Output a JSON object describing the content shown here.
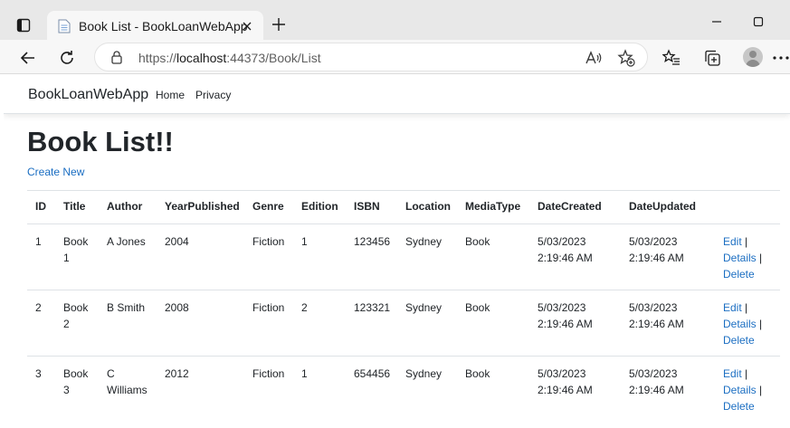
{
  "browser": {
    "tab_title": "Book List - BookLoanWebApp",
    "url_prefix": "https://",
    "url_host": "localhost",
    "url_rest": ":44373/Book/List"
  },
  "site": {
    "brand": "BookLoanWebApp",
    "nav": [
      "Home",
      "Privacy"
    ],
    "heading": "Book List!!",
    "create_new": "Create New"
  },
  "table": {
    "columns": [
      "ID",
      "Title",
      "Author",
      "YearPublished",
      "Genre",
      "Edition",
      "ISBN",
      "Location",
      "MediaType",
      "DateCreated",
      "DateUpdated"
    ],
    "rows": [
      {
        "id": "1",
        "title": [
          "Book",
          "1"
        ],
        "author": [
          "A Jones"
        ],
        "year": "2004",
        "genre": "Fiction",
        "edition": "1",
        "isbn": "123456",
        "location": "Sydney",
        "media": "Book",
        "created": [
          "5/03/2023",
          "2:19:46 AM"
        ],
        "updated": [
          "5/03/2023",
          "2:19:46 AM"
        ]
      },
      {
        "id": "2",
        "title": [
          "Book",
          "2"
        ],
        "author": [
          "B Smith"
        ],
        "year": "2008",
        "genre": "Fiction",
        "edition": "2",
        "isbn": "123321",
        "location": "Sydney",
        "media": "Book",
        "created": [
          "5/03/2023",
          "2:19:46 AM"
        ],
        "updated": [
          "5/03/2023",
          "2:19:46 AM"
        ]
      },
      {
        "id": "3",
        "title": [
          "Book",
          "3"
        ],
        "author": [
          "C",
          "Williams"
        ],
        "year": "2012",
        "genre": "Fiction",
        "edition": "1",
        "isbn": "654456",
        "location": "Sydney",
        "media": "Book",
        "created": [
          "5/03/2023",
          "2:19:46 AM"
        ],
        "updated": [
          "5/03/2023",
          "2:19:46 AM"
        ]
      }
    ],
    "actions": [
      "Edit",
      "Details",
      "Delete"
    ],
    "action_separator": "|"
  }
}
